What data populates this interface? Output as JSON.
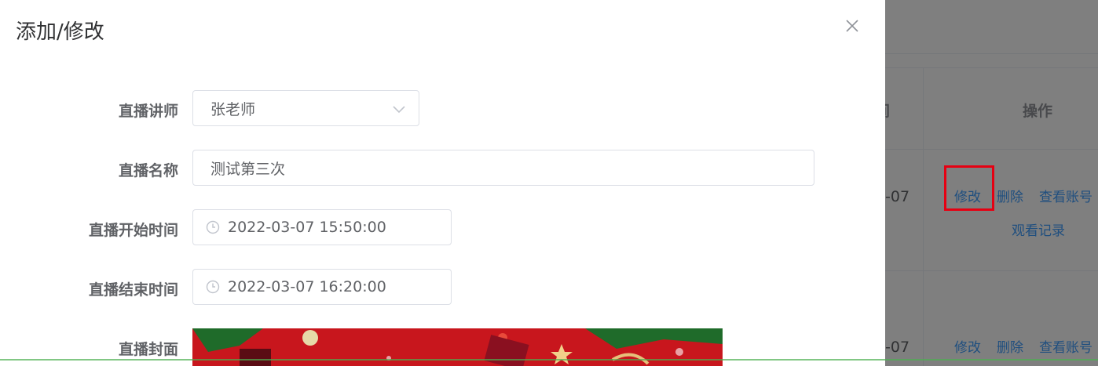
{
  "dialog": {
    "title": "添加/修改",
    "fields": {
      "teacher": {
        "label": "直播讲师",
        "value": "张老师"
      },
      "name": {
        "label": "直播名称",
        "value": "测试第三次"
      },
      "start": {
        "label": "直播开始时间",
        "value": "2022-03-07 15:50:00"
      },
      "end": {
        "label": "直播结束时间",
        "value": "2022-03-07 16:20:00"
      },
      "cover": {
        "label": "直播封面"
      }
    }
  },
  "table": {
    "header_partial": "间",
    "header_actions": "操作",
    "rows": [
      {
        "time_partial": "-07",
        "actions": [
          "修改",
          "删除",
          "查看账号",
          "观看记录"
        ]
      },
      {
        "time_partial": "-07",
        "actions": [
          "修改",
          "删除",
          "查看账号"
        ]
      }
    ]
  },
  "colors": {
    "accent": "#409eff",
    "highlight": "#e60012",
    "overlay": "rgba(0,0,0,0.5)"
  },
  "icons": [
    "close-icon",
    "chevron-down-icon",
    "clock-icon"
  ]
}
